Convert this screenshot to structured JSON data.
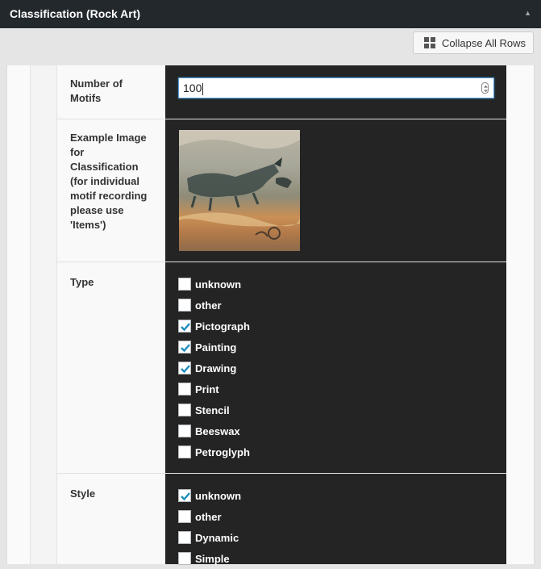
{
  "panel": {
    "title": "Classification (Rock Art)"
  },
  "toolbar": {
    "collapse_label": "Collapse All Rows"
  },
  "fields": {
    "motifs": {
      "label": "Number of Motifs",
      "value": "100"
    },
    "image": {
      "label": "Example Image for Classification (for individual motif recording please use 'Items')"
    },
    "type": {
      "label": "Type",
      "options": [
        {
          "label": "unknown",
          "checked": false
        },
        {
          "label": "other",
          "checked": false
        },
        {
          "label": "Pictograph",
          "checked": true
        },
        {
          "label": "Painting",
          "checked": true
        },
        {
          "label": "Drawing",
          "checked": true
        },
        {
          "label": "Print",
          "checked": false
        },
        {
          "label": "Stencil",
          "checked": false
        },
        {
          "label": "Beeswax",
          "checked": false
        },
        {
          "label": "Petroglyph",
          "checked": false
        }
      ]
    },
    "style": {
      "label": "Style",
      "options": [
        {
          "label": "unknown",
          "checked": true
        },
        {
          "label": "other",
          "checked": false
        },
        {
          "label": "Dynamic",
          "checked": false
        },
        {
          "label": "Simple",
          "checked": false
        }
      ]
    }
  },
  "colors": {
    "accent": "#1e8cbe",
    "field_bg": "#242424",
    "header_bg": "#23282d"
  }
}
